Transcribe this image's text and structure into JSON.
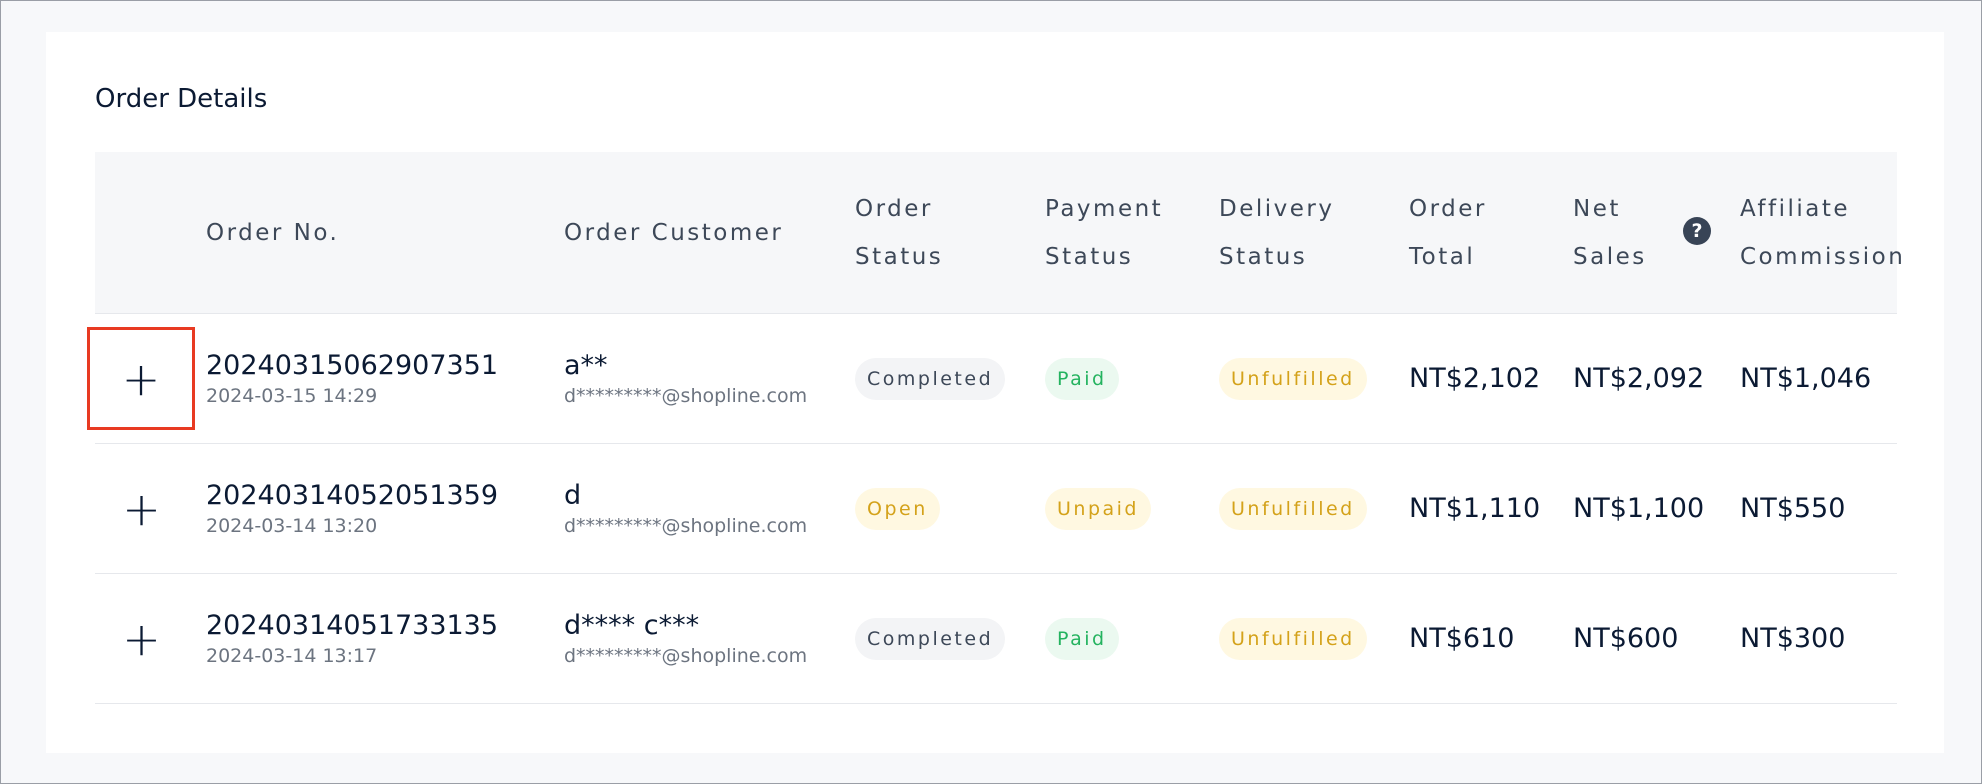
{
  "section": {
    "title": "Order Details"
  },
  "table": {
    "headers": {
      "order_no": "Order No.",
      "order_customer": "Order Customer",
      "order_status_1": "Order",
      "order_status_2": "Status",
      "payment_status_1": "Payment",
      "payment_status_2": "Status",
      "delivery_status_1": "Delivery",
      "delivery_status_2": "Status",
      "order_total_1": "Order",
      "order_total_2": "Total",
      "net_sales_1": "Net",
      "net_sales_2": "Sales",
      "affiliate_commission_1": "Affiliate",
      "affiliate_commission_2": "Commission",
      "help_icon": "?"
    },
    "expand_icon": "+",
    "rows": [
      {
        "order_no": "20240315062907351",
        "date": "2024-03-15 14:29",
        "customer_name": "a**",
        "customer_email": "d*********@shopline.com",
        "order_status": "Completed",
        "payment_status": "Paid",
        "delivery_status": "Unfulfilled",
        "order_total": "NT$2,102",
        "net_sales": "NT$2,092",
        "affiliate_commission": "NT$1,046"
      },
      {
        "order_no": "20240314052051359",
        "date": "2024-03-14 13:20",
        "customer_name": "d",
        "customer_email": "d*********@shopline.com",
        "order_status": "Open",
        "payment_status": "Unpaid",
        "delivery_status": "Unfulfilled",
        "order_total": "NT$1,110",
        "net_sales": "NT$1,100",
        "affiliate_commission": "NT$550"
      },
      {
        "order_no": "20240314051733135",
        "date": "2024-03-14 13:17",
        "customer_name": "d**** c***",
        "customer_email": "d*********@shopline.com",
        "order_status": "Completed",
        "payment_status": "Paid",
        "delivery_status": "Unfulfilled",
        "order_total": "NT$610",
        "net_sales": "NT$600",
        "affiliate_commission": "NT$300"
      }
    ]
  },
  "colors": {
    "highlight_border": "#e83a22",
    "status_green": "#24b35f",
    "status_yellow": "#d4a21a",
    "status_gray": "#3d4858"
  }
}
